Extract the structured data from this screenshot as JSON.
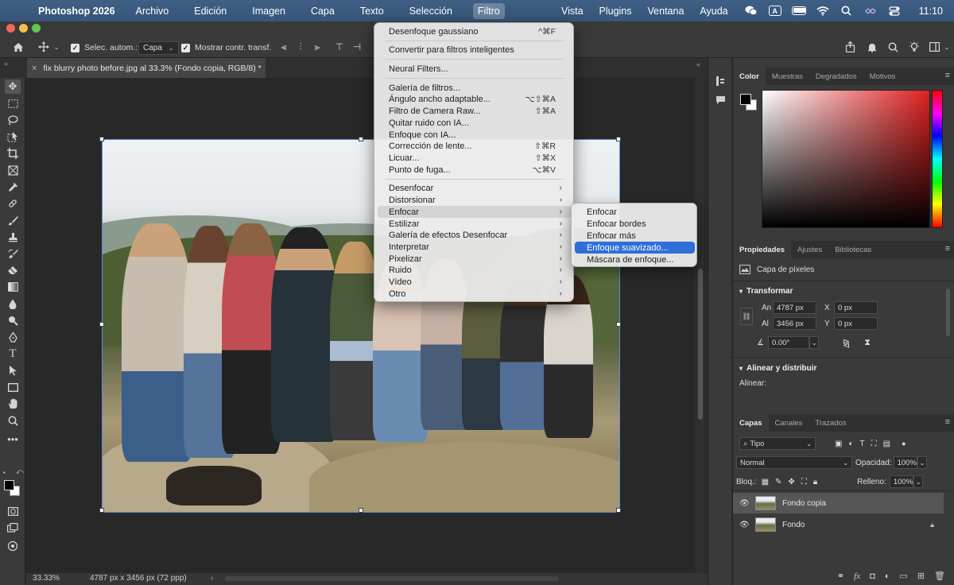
{
  "menubar": {
    "app_name": "Photoshop 2026",
    "menus": [
      "Archivo",
      "Edición",
      "Imagen",
      "Capa",
      "Texto",
      "Selección",
      "Filtro"
    ],
    "right_menus": [
      "Vista",
      "Plugins",
      "Ventana",
      "Ayuda"
    ],
    "input_source": "A",
    "time": "11:10"
  },
  "options_bar": {
    "auto_select_label": "Selec. autom.:",
    "auto_select_target": "Capa",
    "show_transform_label": "Mostrar contr. transf."
  },
  "document": {
    "tab_title": "fix blurry photo before.jpg al 33.3% (Fondo copia, RGB/8) *"
  },
  "status": {
    "zoom": "33.33%",
    "dimensions": "4787 px x 3456 px (72 ppp)"
  },
  "filter_menu": {
    "items": [
      {
        "label": "Desenfoque gaussiano",
        "shortcut": "^⌘F"
      },
      {
        "label": "Convertir para filtros inteligentes"
      },
      {
        "label": "Neural Filters..."
      },
      {
        "label": "Galería de filtros..."
      },
      {
        "label": "Ángulo ancho adaptable...",
        "shortcut": "⌥⇧⌘A"
      },
      {
        "label": "Filtro de Camera Raw...",
        "shortcut": "⇧⌘A"
      },
      {
        "label": "Quitar ruido con IA..."
      },
      {
        "label": "Enfoque con IA..."
      },
      {
        "label": "Corrección de lente...",
        "shortcut": "⇧⌘R"
      },
      {
        "label": "Licuar...",
        "shortcut": "⇧⌘X"
      },
      {
        "label": "Punto de fuga...",
        "shortcut": "⌥⌘V"
      },
      {
        "label": "Desenfocar"
      },
      {
        "label": "Distorsionar"
      },
      {
        "label": "Enfocar"
      },
      {
        "label": "Estilizar"
      },
      {
        "label": "Galería de efectos Desenfocar"
      },
      {
        "label": "Interpretar"
      },
      {
        "label": "Pixelizar"
      },
      {
        "label": "Ruido"
      },
      {
        "label": "Vídeo"
      },
      {
        "label": "Otro"
      }
    ],
    "submenu_arrow": "›"
  },
  "enfocar_submenu": {
    "items": [
      "Enfocar",
      "Enfocar bordes",
      "Enfocar más",
      "Enfoque suavizado...",
      "Máscara de enfoque..."
    ],
    "selected": "Enfoque suavizado..."
  },
  "color_panel": {
    "tabs": [
      "Color",
      "Muestras",
      "Degradados",
      "Motivos"
    ],
    "active_tab": "Color",
    "foreground": "#000000",
    "background": "#ffffff"
  },
  "properties_panel": {
    "tabs": [
      "Propiedades",
      "Ajustes",
      "Bibliotecas"
    ],
    "layer_type": "Capa de píxeles",
    "transform_title": "Transformar",
    "width_label": "An",
    "width": "4787 px",
    "height_label": "Al",
    "height": "3456 px",
    "x_label": "X",
    "x": "0 px",
    "y_label": "Y",
    "y": "0 px",
    "angle": "0.00°",
    "align_title": "Alinear y distribuir",
    "align_label": "Alinear:"
  },
  "layers_panel": {
    "tabs": [
      "Capas",
      "Canales",
      "Trazados"
    ],
    "filter_kind": "Tipo",
    "blend_mode": "Normal",
    "opacity_label": "Opacidad:",
    "opacity": "100%",
    "lock_label": "Bloq.:",
    "fill_label": "Relleno:",
    "fill": "100%",
    "layers": [
      {
        "name": "Fondo copia",
        "selected": true,
        "locked": false
      },
      {
        "name": "Fondo",
        "selected": false,
        "locked": true
      }
    ]
  }
}
